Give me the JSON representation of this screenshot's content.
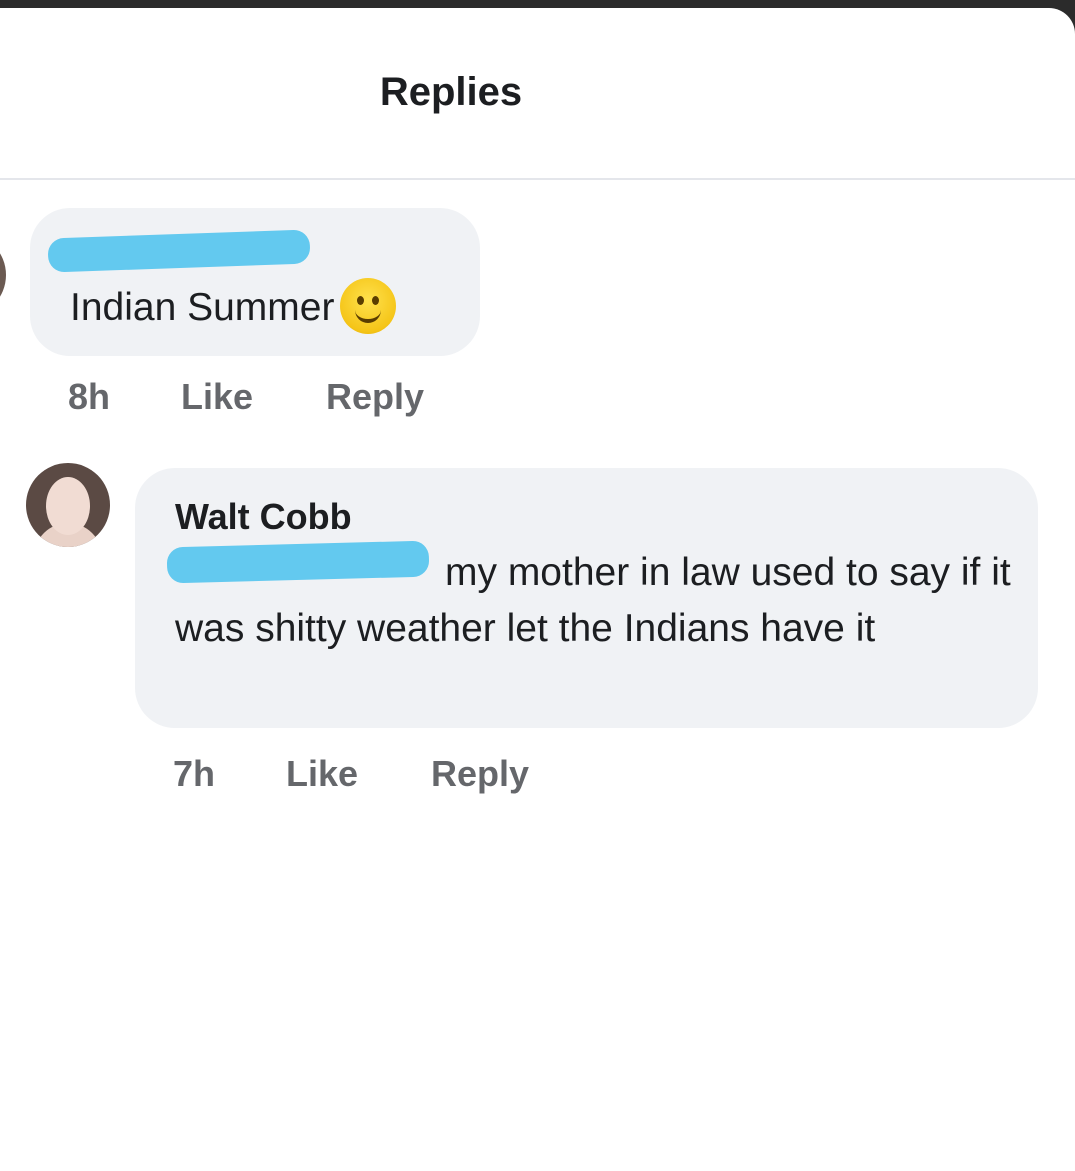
{
  "header": {
    "title": "Replies"
  },
  "comments": [
    {
      "author_redacted": true,
      "text": "Indian Summer",
      "emoji": "slightly-smiling-face-icon",
      "time": "8h",
      "like_label": "Like",
      "reply_label": "Reply"
    },
    {
      "author": "Walt Cobb",
      "mention_redacted": true,
      "text": "my mother in law used to say if it was shitty weather let the Indians have it",
      "time": "7h",
      "like_label": "Like",
      "reply_label": "Reply"
    }
  ],
  "colors": {
    "bubble": "#f0f2f5",
    "redaction": "#63c9ef",
    "text": "#1c1e21",
    "muted": "#65676b"
  }
}
